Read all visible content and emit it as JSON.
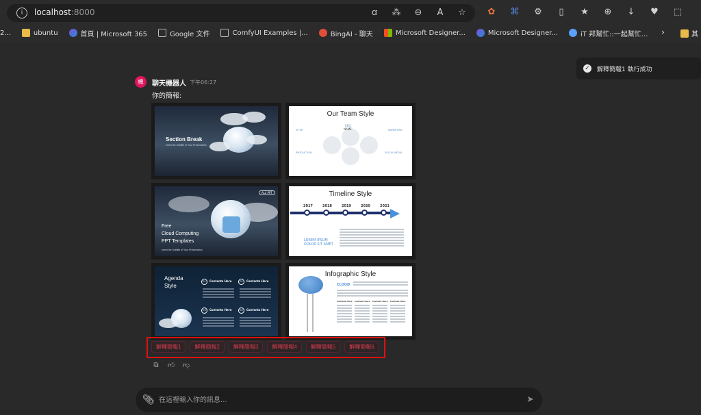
{
  "browser": {
    "url_host": "localhost",
    "url_port": ":8000",
    "address_tools": [
      "read-aloud-icon",
      "translate-icon",
      "zoom-out-icon",
      "text-size-icon",
      "favorite-star-icon"
    ],
    "extension_icons": [
      "extension-color-icon",
      "google-translate-icon",
      "puzzle-icon",
      "split-screen-icon",
      "favorites-icon",
      "collections-icon",
      "download-icon",
      "health-icon",
      "screenshot-icon"
    ],
    "bookmarks": [
      {
        "label": "2...",
        "icon": "none"
      },
      {
        "label": "ubuntu",
        "icon": "folder"
      },
      {
        "label": "首頁 | Microsoft 365",
        "icon": "m365"
      },
      {
        "label": "Google 文件",
        "icon": "doc"
      },
      {
        "label": "ComfyUI Examples |...",
        "icon": "doc"
      },
      {
        "label": "BingAI - 聊天",
        "icon": "bing"
      },
      {
        "label": "Microsoft Designer...",
        "icon": "ms"
      },
      {
        "label": "Microsoft Designer...",
        "icon": "m365"
      },
      {
        "label": "iT 邦幫忙::一起幫忙...",
        "icon": "it"
      }
    ],
    "bookmarks_last_label": "其"
  },
  "toast": {
    "text": "解釋簡報1 執行成功"
  },
  "message": {
    "sender": "聊天機器人",
    "avatar_text": "機",
    "time": "下午06:27",
    "intro": "你的簡報:"
  },
  "slides": [
    {
      "title": "Section Break",
      "subtitle": "Insert the Subtitle of Your Presentation",
      "style": "dark"
    },
    {
      "title": "Our Team Style",
      "labels": [
        "CEO",
        "NAME",
        "VP HR",
        "MARKETING",
        "PRODUCTION",
        "SOCIAL MEDIA"
      ],
      "style": "light"
    },
    {
      "title": "Free\nCloud Computing\nPPT Templates",
      "subtitle": "Insert the Subtitle of Your Presentation",
      "tag": "ALL PPT",
      "style": "dark"
    },
    {
      "title": "Timeline Style",
      "years": [
        "2017",
        "2018",
        "2019",
        "2020",
        "2021"
      ],
      "side_text": "LOREM IPSUM\nDOLOR SIT AMET",
      "style": "light"
    },
    {
      "title": "Agenda\nStyle",
      "items": [
        "01",
        "02",
        "03",
        "04"
      ],
      "item_label": "Contents Here",
      "style": "dark"
    },
    {
      "title": "Infographic Style",
      "keyword": "CLOUD",
      "col_label": "Content Here",
      "style": "light"
    }
  ],
  "explain_buttons": [
    "解釋簡報1",
    "解釋簡報2",
    "解釋簡報3",
    "解釋簡報4",
    "解釋簡報5",
    "解釋簡報6"
  ],
  "composer": {
    "placeholder": "在這裡輸入你的訊息..."
  }
}
